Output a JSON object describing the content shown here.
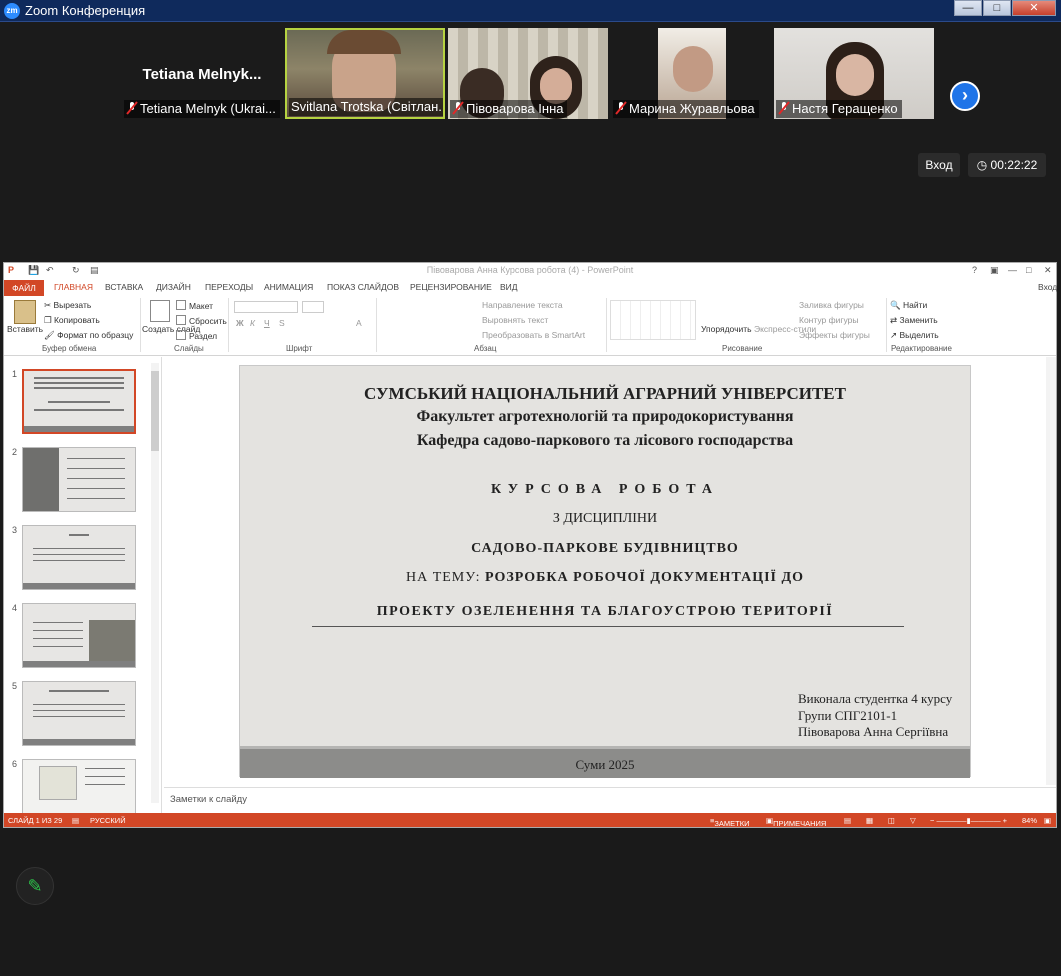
{
  "zoom": {
    "title": "Zoom Конференция",
    "logo": "zm",
    "colors": {
      "accent": "#2d8cff",
      "active_speaker": "#b6d341"
    },
    "window_controls": {
      "minimize": "minimize-icon",
      "maximize": "maximize-icon",
      "close": "close-icon"
    },
    "participants": [
      {
        "name": "Tetiana Melnyk (Ukrai...",
        "display_name": "Tetiana  Melnyk...",
        "muted": true
      },
      {
        "name": "Svitlana Trotska (Світлан...",
        "muted": false,
        "active": true
      },
      {
        "name": "Півоварова Інна",
        "muted": true
      },
      {
        "name": "Марина Журавльова",
        "muted": true
      },
      {
        "name": "Настя Геращенко",
        "muted": true
      }
    ],
    "enter_label": "Вход",
    "timer": "00:22:22"
  },
  "ppt": {
    "window_title": "Півоварова Анна Курсова робота (4) - PowerPoint",
    "user": "Вход",
    "tabs": [
      "ФАЙЛ",
      "ГЛАВНАЯ",
      "ВСТАВКА",
      "ДИЗАЙН",
      "ПЕРЕХОДЫ",
      "АНИМАЦИЯ",
      "ПОКАЗ СЛАЙДОВ",
      "РЕЦЕНЗИРОВАНИЕ",
      "ВИД"
    ],
    "ribbon": {
      "paste": "Вставить",
      "cut": "Вырезать",
      "copy": "Копировать",
      "format_painter": "Формат по образцу",
      "clipboard_group": "Буфер обмена",
      "new_slide": "Создать слайд",
      "layout": "Макет",
      "reset": "Сбросить",
      "section": "Раздел",
      "slides_group": "Слайды",
      "font_group": "Шрифт",
      "text_direction": "Направление текста",
      "align_text": "Выровнять текст",
      "smartart": "Преобразовать в SmartArt",
      "paragraph_group": "Абзац",
      "arrange": "Упорядочить",
      "quick_styles": "Экспресс-стили",
      "shape_fill": "Заливка фигуры",
      "shape_outline": "Контур фигуры",
      "shape_effects": "Эффекты фигуры",
      "drawing_group": "Рисование",
      "find": "Найти",
      "replace": "Заменить",
      "select": "Выделить",
      "editing_group": "Редактирование"
    },
    "thumb_numbers": [
      "1",
      "2",
      "3",
      "4",
      "5",
      "6"
    ],
    "slide": {
      "university": "СУМСЬКИЙ НАЦІОНАЛЬНИЙ АГРАРНИЙ УНІВЕРСИТЕТ",
      "faculty": "Факультет агротехнологій та природокористування",
      "department": "Кафедра садово-паркового та лісового господарства",
      "work": "КУРСОВА  РОБОТА",
      "discipline": "З ДИСЦИПЛІНИ",
      "subject": "САДОВО-ПАРКОВЕ БУДІВНИЦТВО",
      "theme_prefix": "НА ТЕМУ: ",
      "theme": "РОЗРОБКА РОБОЧОЇ ДОКУМЕНТАЦІЇ ДО",
      "theme2": "ПРОЕКТУ ОЗЕЛЕНЕННЯ ТА БЛАГОУСТРОЮ ТЕРИТОРІЇ",
      "author1": "Виконала студентка 4 курсу",
      "author2": "Групи СПГ2101-1",
      "author3": "Півоварова Анна Сергіївна",
      "city": "Суми 2025"
    },
    "notes_placeholder": "Заметки к слайду",
    "status": {
      "slide": "СЛАЙД 1 ИЗ 29",
      "lang": "РУССКИЙ",
      "notes": "ЗАМЕТКИ",
      "comments": "ПРИМЕЧАНИЯ",
      "zoom": "84%"
    },
    "colors": {
      "accent": "#d24726"
    }
  },
  "annotate_icon": "pencil-icon"
}
